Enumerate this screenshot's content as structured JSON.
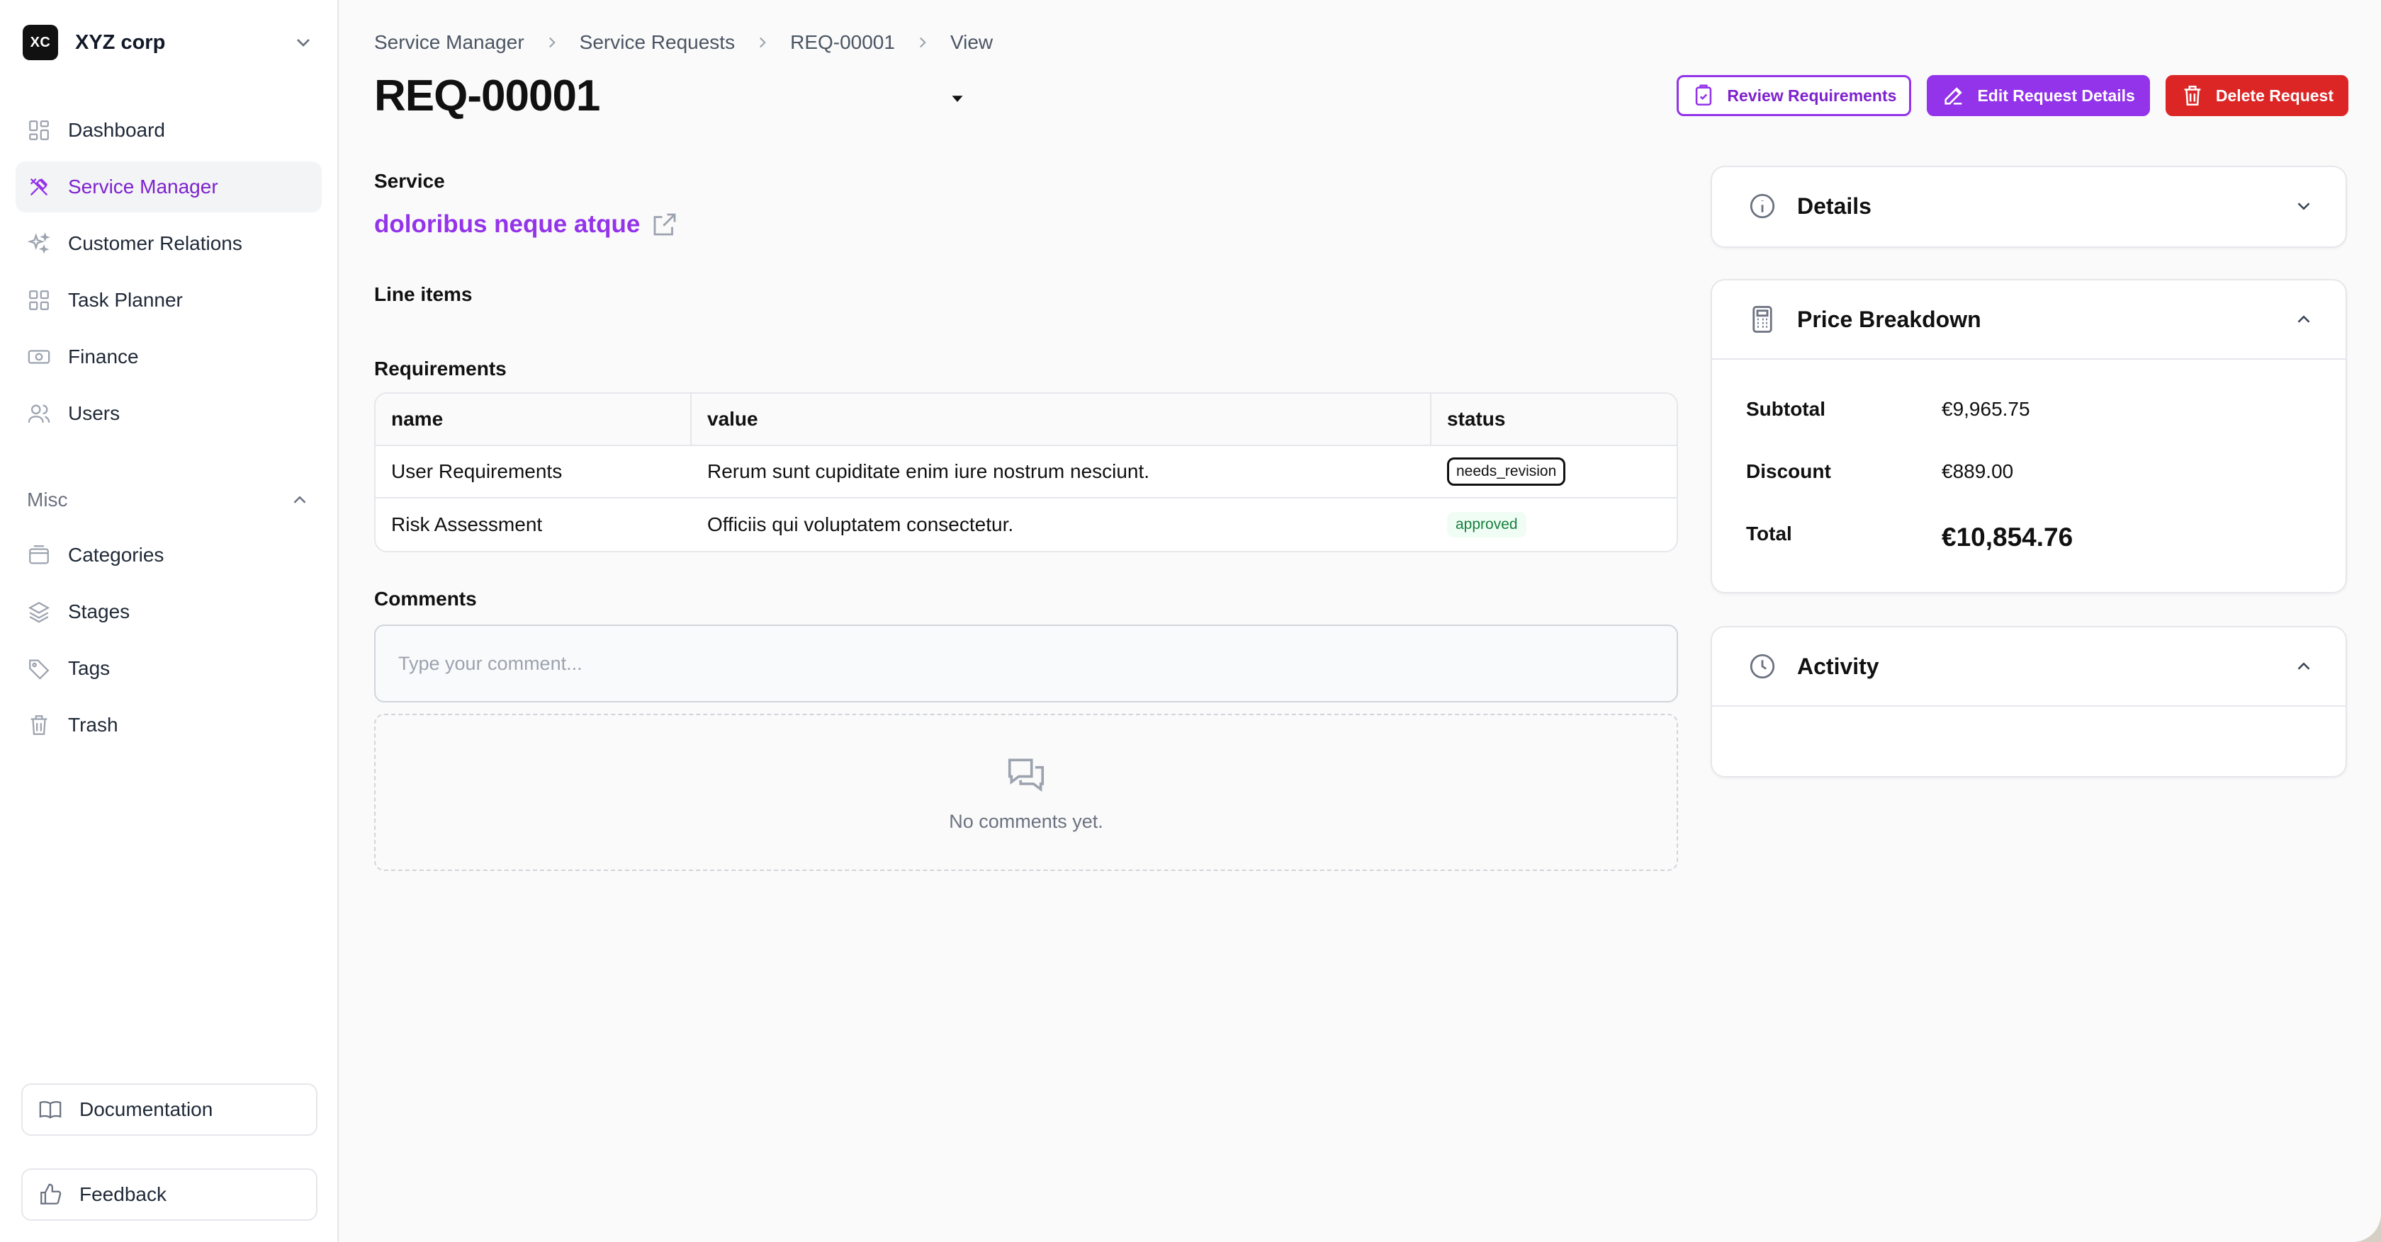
{
  "org": {
    "initials": "XC",
    "name": "XYZ corp"
  },
  "nav": {
    "items": [
      {
        "label": "Dashboard"
      },
      {
        "label": "Service Manager"
      },
      {
        "label": "Customer Relations"
      },
      {
        "label": "Task Planner"
      },
      {
        "label": "Finance"
      },
      {
        "label": "Users"
      }
    ],
    "misc_label": "Misc",
    "misc_items": [
      {
        "label": "Categories"
      },
      {
        "label": "Stages"
      },
      {
        "label": "Tags"
      },
      {
        "label": "Trash"
      }
    ],
    "documentation": "Documentation",
    "feedback": "Feedback"
  },
  "breadcrumb": [
    "Service Manager",
    "Service Requests",
    "REQ-00001",
    "View"
  ],
  "page": {
    "title": "REQ-00001"
  },
  "actions": {
    "review": "Review Requirements",
    "edit": "Edit Request Details",
    "delete": "Delete Request"
  },
  "service": {
    "label": "Service",
    "name": "doloribus neque atque"
  },
  "line_items_label": "Line items",
  "requirements": {
    "label": "Requirements",
    "columns": [
      "name",
      "value",
      "status"
    ],
    "rows": [
      {
        "name": "User Requirements",
        "value": "Rerum sunt cupiditate enim iure nostrum nesciunt.",
        "status": "needs_revision"
      },
      {
        "name": "Risk Assessment",
        "value": "Officiis qui voluptatem consectetur.",
        "status": "approved"
      }
    ]
  },
  "comments": {
    "label": "Comments",
    "placeholder": "Type your comment...",
    "empty": "No comments yet."
  },
  "details": {
    "title": "Details"
  },
  "price": {
    "title": "Price Breakdown",
    "subtotal_label": "Subtotal",
    "subtotal": "€9,965.75",
    "discount_label": "Discount",
    "discount": "€889.00",
    "total_label": "Total",
    "total": "€10,854.76"
  },
  "activity": {
    "title": "Activity"
  },
  "colors": {
    "accent": "#9333ea",
    "danger": "#dc2626",
    "success": "#15803d"
  }
}
